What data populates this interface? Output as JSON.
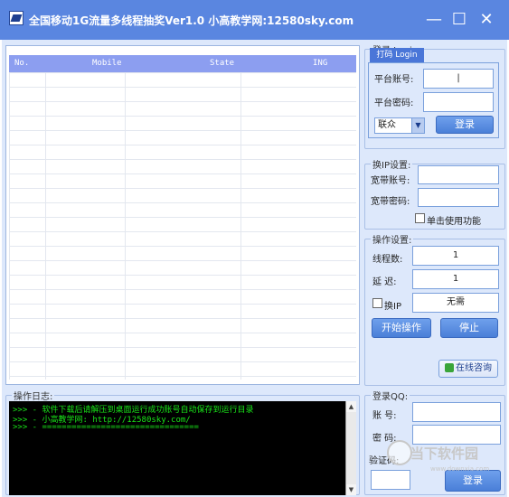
{
  "window": {
    "title": "全国移动1G流量多线程抽奖Ver1.0 小高教学网:12580sky.com",
    "minimize": "—",
    "maximize": "☐",
    "close": "✕"
  },
  "grid": {
    "columns": [
      "No.",
      "Mobile",
      "State",
      "ING"
    ]
  },
  "login": {
    "legend": "登录 Login:",
    "tab": "打码 Login",
    "account_label": "平台账号:",
    "account_value": "|",
    "password_label": "平台密码:",
    "password_value": "",
    "provider_selected": "联众",
    "login_button": "登录"
  },
  "ipchange": {
    "legend": "换IP设置:",
    "bb_account_label": "宽带账号:",
    "bb_password_label": "宽带密码:",
    "single_click_label": "单击使用功能"
  },
  "operation": {
    "legend": "操作设置:",
    "threads_label": "线程数:",
    "threads_value": "1",
    "delay_label": "延 迟:",
    "delay_value": "1",
    "change_ip_label": "换IP",
    "change_ip_value": "无需",
    "start_button": "开始操作",
    "stop_button": "停止",
    "consult_button": "在线咨询"
  },
  "log": {
    "legend": "操作日志:",
    "lines": [
      ">>> - 软件下载后请解压到桌面运行成功账号自动保存到运行目录",
      ">>> - 小高教学网: http://12580sky.com/",
      ">>> - ================================"
    ]
  },
  "qq": {
    "legend": "登录QQ:",
    "account_label": "账 号:",
    "password_label": "密 码:",
    "verify_label": "验证码:",
    "login_button": "登录"
  },
  "watermark": {
    "text": "当下软件园",
    "url": "www.downxia.com"
  }
}
